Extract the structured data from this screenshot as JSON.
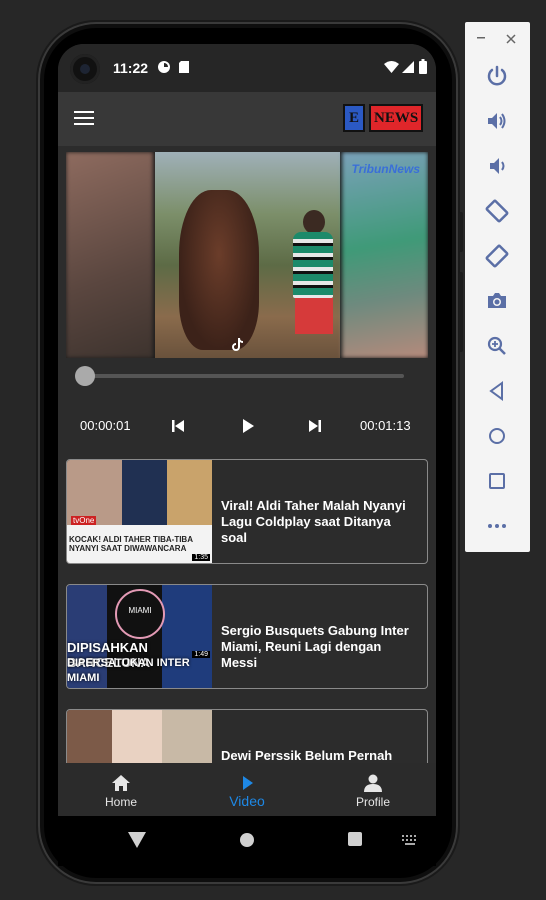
{
  "status_bar": {
    "time": "11:22"
  },
  "app_bar": {
    "menu_icon": "hamburger-menu-icon",
    "logo": {
      "e": "E",
      "news": "NEWS"
    }
  },
  "video": {
    "watermark": "TribunNews",
    "current_time": "00:00:01",
    "duration": "00:01:13",
    "progress": 0.01
  },
  "news": [
    {
      "title": "Viral! Aldi Taher Malah Nyanyi Lagu Coldplay saat Ditanya soal",
      "thumb_caption": "KOCAK! ALDI TAHER TIBA-TIBA NYANYI SAAT DIWAWANCARA",
      "thumb_channel": "tvOne",
      "thumb_duration": "1:35"
    },
    {
      "title": "Sergio Busquets Gabung Inter Miami, Reuni Lagi dengan Messi",
      "thumb_caption_1": "DIPISAHKAN BARCELONA",
      "thumb_caption_2": "DIPERSATUKAN INTER MIAMI",
      "thumb_crest": "MIAMI",
      "thumb_duration": "1:49"
    },
    {
      "title": "Dewi Perssik Belum Pernah"
    }
  ],
  "bottom_nav": [
    {
      "label": "Home",
      "icon": "home-icon",
      "active": false
    },
    {
      "label": "Video",
      "icon": "play-icon",
      "active": true
    },
    {
      "label": "Profile",
      "icon": "person-icon",
      "active": false
    }
  ],
  "colors": {
    "accent": "#1e88e5",
    "background": "#2c2c2c",
    "app_bar": "#383838",
    "logo_blue": "#2b59c3",
    "logo_red": "#e0262a"
  },
  "emulator_toolbar": {
    "buttons": [
      "power-icon",
      "volume-up-icon",
      "volume-down-icon",
      "rotate-left-icon",
      "rotate-right-icon",
      "camera-icon",
      "zoom-icon",
      "back-icon",
      "home-icon",
      "overview-icon",
      "more-icon"
    ]
  }
}
